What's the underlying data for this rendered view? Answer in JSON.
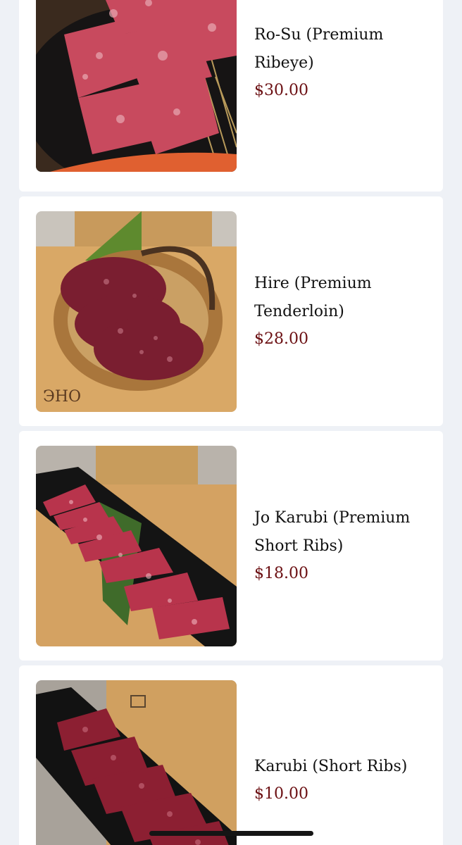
{
  "menu": {
    "items": [
      {
        "name": "Ro-Su (Premium Ribeye)",
        "price": "$30.00",
        "image": "ribeye-slices-on-black-plate-photo"
      },
      {
        "name": "Hire (Premium Tenderloin)",
        "price": "$28.00",
        "image": "tenderloin-in-wicker-basket-photo"
      },
      {
        "name": "Jo Karubi (Premium Short Ribs)",
        "price": "$18.00",
        "image": "short-ribs-on-black-tray-photo"
      },
      {
        "name": "Karubi (Short Ribs)",
        "price": "$10.00",
        "image": "short-ribs-on-black-tray-photo"
      }
    ]
  },
  "colors": {
    "background": "#eef1f6",
    "card": "#ffffff",
    "price": "#6b0f12",
    "text": "#111111"
  }
}
